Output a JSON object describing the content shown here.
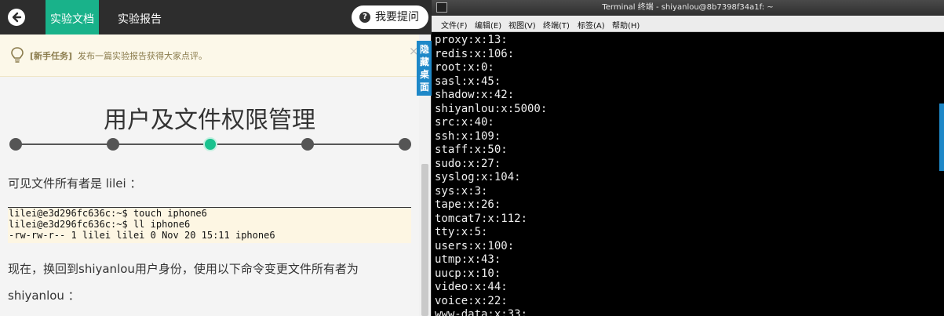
{
  "left": {
    "topbar": {
      "tab_doc": "实验文档",
      "tab_report": "实验报告",
      "ask_button": "我要提问",
      "ask_icon_glyph": "?"
    },
    "notice": {
      "tag": "[新手任务]",
      "text": "发布一篇实验报告获得大家点评。",
      "close": "×"
    },
    "title": "用户及文件权限管理",
    "progress": {
      "steps": 5,
      "active_step": 3
    },
    "para1": "可见文件所有者是 lilei ：",
    "code_lines": [
      "lilei@e3d296fc636c:~$ touch iphone6",
      "lilei@e3d296fc636c:~$ ll iphone6",
      "-rw-rw-r-- 1 lilei lilei 0 Nov 20 15:11 iphone6"
    ],
    "para2": "现在，换回到shiyanlou用户身份，使用以下命令变更文件所有者为",
    "para3": "shiyanlou ：",
    "hide_desktop": "隐藏桌面"
  },
  "terminal": {
    "title": "Terminal 终端 - shiyanlou@8b7398f34a1f: ~",
    "menu": [
      "文件(F)",
      "编辑(E)",
      "视图(V)",
      "终端(T)",
      "标签(A)",
      "帮助(H)"
    ],
    "lines": [
      "proxy:x:13:",
      "redis:x:106:",
      "root:x:0:",
      "sasl:x:45:",
      "shadow:x:42:",
      "shiyanlou:x:5000:",
      "src:x:40:",
      "ssh:x:109:",
      "staff:x:50:",
      "sudo:x:27:",
      "syslog:x:104:",
      "sys:x:3:",
      "tape:x:26:",
      "tomcat7:x:112:",
      "tty:x:5:",
      "users:x:100:",
      "utmp:x:43:",
      "uucp:x:10:",
      "video:x:44:",
      "voice:x:22:",
      "www-data:x:33:"
    ]
  },
  "colors": {
    "accent": "#19b28a",
    "topbar_bg": "#2d2d2d",
    "terminal_bg": "#000000",
    "side_button": "#1e88c8"
  }
}
